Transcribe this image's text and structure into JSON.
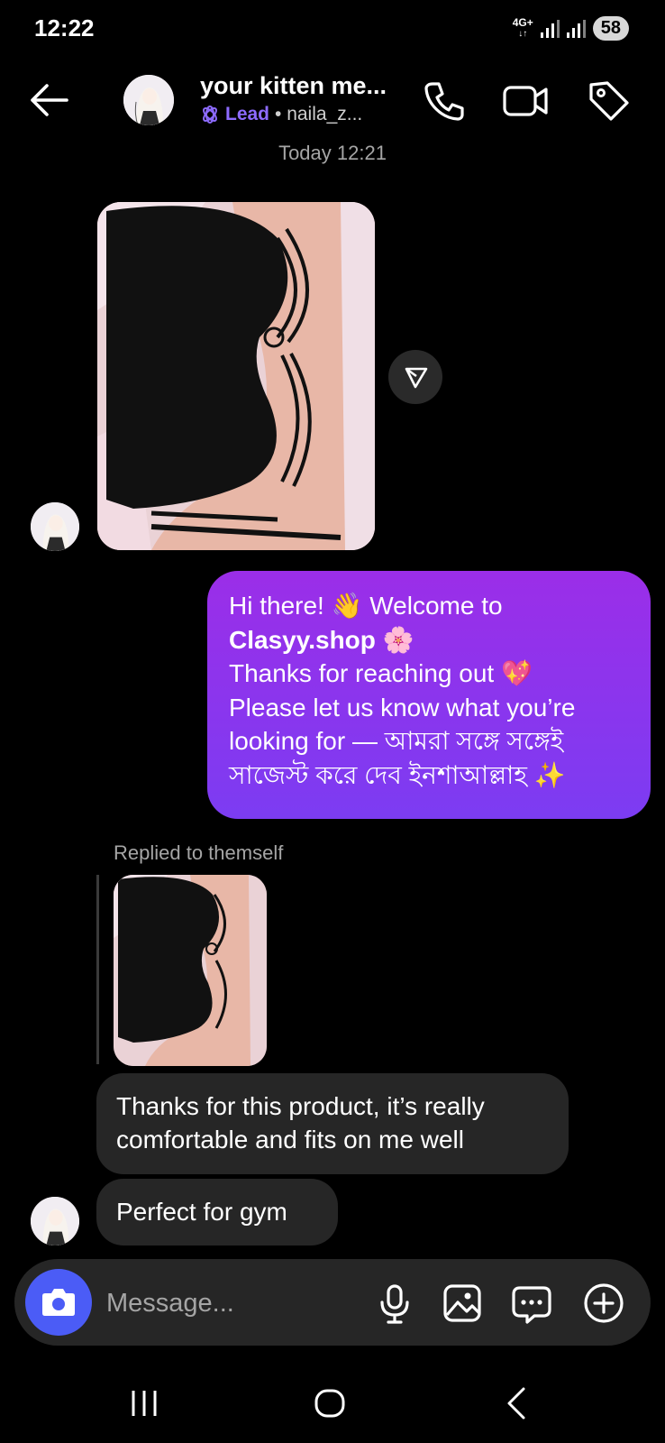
{
  "status_bar": {
    "time": "12:22",
    "network": "4G+",
    "battery": "58"
  },
  "header": {
    "name": "your kitten me...",
    "lead_label": "Lead",
    "handle": "• naila_z..."
  },
  "conversation": {
    "day_separator": "Today 12:21",
    "outgoing": {
      "line1": "Hi there! 👋 Welcome to",
      "line2_bold": "Clasyy.shop",
      "line2_emoji": " 🌸",
      "line3": "Thanks for reaching out 💖",
      "line4": "Please let us know what you’re",
      "line5": "looking for — আমরা সঙ্গে সঙ্গেই",
      "line6": "সাজেস্ট করে দেব ইনশাআল্লাহ ✨"
    },
    "replied_label": "Replied to themself",
    "incoming_1": {
      "line1": "Thanks for this product, it’s really",
      "line2": "comfortable and fits on me well"
    },
    "incoming_2": "Perfect for gym"
  },
  "composer": {
    "placeholder": "Message..."
  },
  "colors": {
    "accent": "#8d6bff",
    "bubble_out_top": "#9b2ee8",
    "bubble_out_bottom": "#7c3cf2",
    "bubble_in": "#262626",
    "camera": "#4b5cf6"
  },
  "icons": [
    "back-arrow-icon",
    "phone-icon",
    "video-call-icon",
    "tag-icon",
    "share-icon",
    "camera-icon",
    "microphone-icon",
    "gallery-icon",
    "sticker-icon",
    "plus-icon",
    "nav-recents-icon",
    "nav-home-icon",
    "nav-back-icon"
  ]
}
